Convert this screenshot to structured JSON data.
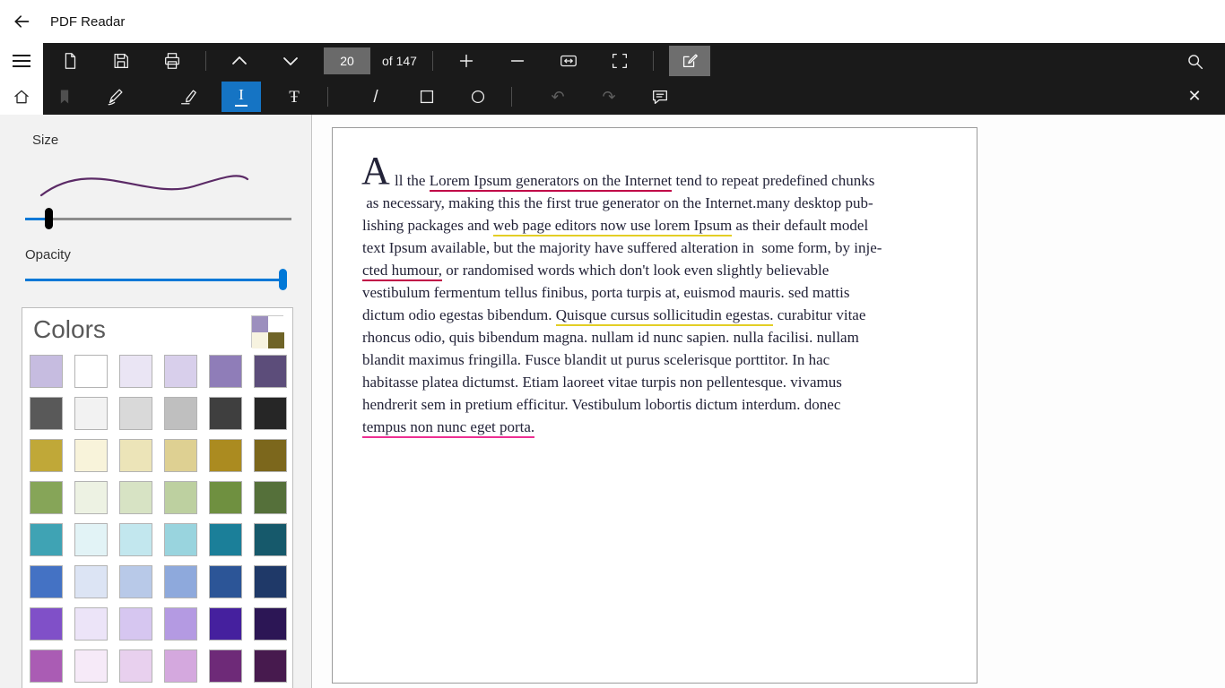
{
  "app": {
    "title": "PDF Readar"
  },
  "toolbar": {
    "page_number": "20",
    "page_count": "of 147",
    "selected_tool": "text",
    "selected_tool_color": "#1574c4",
    "annotate_button_color": "#6e6e6e"
  },
  "icons": {
    "close": "✕",
    "undo": "↶",
    "redo": "↷",
    "slash": "/",
    "strikethrough": "Ŧ",
    "text_tool": "I"
  },
  "side_panel": {
    "size_label": "Size",
    "opacity_label": "Opacity",
    "stroke_color": "#5b2a66",
    "accent_color": "#0078d7",
    "colors_card": {
      "title": "Colors",
      "checker_icon": [
        "#9c8fbe",
        "#ffffff",
        "#f7f3e0",
        "#6f6428"
      ],
      "swatch_rows": [
        [
          "#c6bce0",
          "#ffffff",
          "#eae5f4",
          "#d8cfeb",
          "#8f7db8",
          "#5c4d7a"
        ],
        [
          "#595959",
          "#f2f2f2",
          "#d9d9d9",
          "#bfbfbf",
          "#3f3f3f",
          "#262626"
        ],
        [
          "#c0a838",
          "#f8f3da",
          "#ece4b8",
          "#ded092",
          "#ab8b20",
          "#7c671c"
        ],
        [
          "#86a558",
          "#edf2e3",
          "#d7e3c4",
          "#bdd0a0",
          "#6f9040",
          "#55703a"
        ],
        [
          "#3fa3b4",
          "#e2f3f6",
          "#c2e7ee",
          "#99d4de",
          "#1b7f99",
          "#16596b"
        ],
        [
          "#4472c4",
          "#dce4f4",
          "#b8c9e8",
          "#8ea9dc",
          "#2c5597",
          "#1f3968"
        ],
        [
          "#8050c8",
          "#ece4f8",
          "#d6c6f0",
          "#b49ae2",
          "#45209e",
          "#2c1655"
        ],
        [
          "#aa5cb4",
          "#f6eaf8",
          "#e8d0ee",
          "#d4a8de",
          "#6e2a78",
          "#471a4e"
        ]
      ]
    }
  },
  "document": {
    "drop_cap": "A",
    "text_color": "#232338",
    "underline_colors": {
      "red": "#c00047",
      "yellow": "#e3ce25",
      "pink": "#ee2f92"
    },
    "lines": [
      [
        {
          "t": "ll the "
        },
        {
          "t": "Lorem Ipsum generators on the Internet",
          "u": "red"
        },
        {
          "t": " tend to repeat predefined chunks"
        }
      ],
      [
        {
          "t": " as necessary, making this the first true generator on the Internet.many desktop pub-"
        }
      ],
      [
        {
          "t": "lishing packages and "
        },
        {
          "t": "web page editors now use lorem Ipsum",
          "u": "yellow"
        },
        {
          "t": " as their default model"
        }
      ],
      [
        {
          "t": "text Ipsum available, but the majority have suffered alteration in  some form, by inje-"
        }
      ],
      [
        {
          "t": "cted humour,",
          "u": "red"
        },
        {
          "t": " or randomised words which don't look even slightly believable"
        }
      ],
      [
        {
          "t": "vestibulum fermentum tellus finibus, porta turpis at, euismod mauris. sed mattis"
        }
      ],
      [
        {
          "t": "dictum odio egestas bibendum. "
        },
        {
          "t": "Quisque cursus sollicitudin egestas.",
          "u": "yellow"
        },
        {
          "t": " curabitur vitae"
        }
      ],
      [
        {
          "t": "rhoncus odio, quis bibendum magna. nullam id nunc sapien. nulla facilisi. nullam"
        }
      ],
      [
        {
          "t": "blandit maximus fringilla. Fusce blandit ut purus scelerisque porttitor. In hac"
        }
      ],
      [
        {
          "t": "habitasse platea dictumst. Etiam laoreet vitae turpis non pellentesque. vivamus"
        }
      ],
      [
        {
          "t": "hendrerit sem in pretium efficitur. Vestibulum lobortis dictum interdum. donec"
        }
      ],
      [
        {
          "t": "tempus non nunc eget porta.",
          "u": "pink"
        }
      ]
    ]
  }
}
